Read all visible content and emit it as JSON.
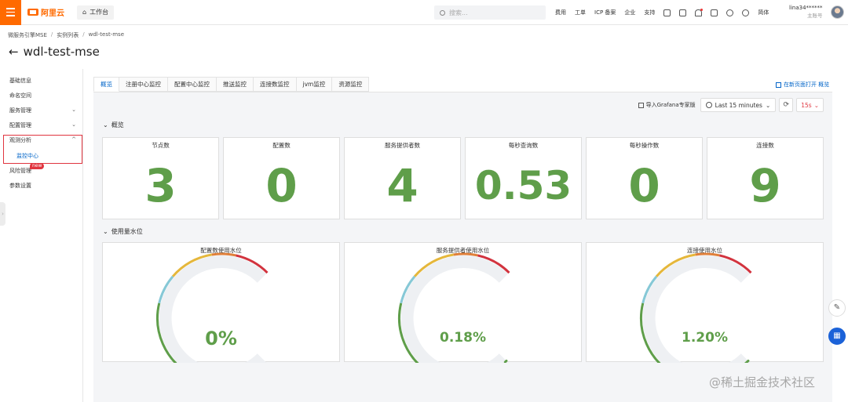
{
  "topbar": {
    "logo_text": "阿里云",
    "workbench_label": "工作台",
    "search_placeholder": "搜索...",
    "links": [
      "费用",
      "工单",
      "ICP 备案",
      "企业",
      "支持"
    ],
    "lang": "简体",
    "user_name": "lina34******",
    "user_role": "主账号"
  },
  "breadcrumb": [
    "微服务引擎MSE",
    "实例列表",
    "wdl-test-mse"
  ],
  "page_title": "wdl-test-mse",
  "sidebar": {
    "items": [
      {
        "label": "基础信息",
        "chevron": ""
      },
      {
        "label": "命名空间",
        "chevron": ""
      },
      {
        "label": "服务管理",
        "chevron": "⌄"
      },
      {
        "label": "配置管理",
        "chevron": "⌄"
      },
      {
        "label": "观测分析",
        "chevron": "^"
      },
      {
        "label": "风险管理",
        "chevron": ""
      },
      {
        "label": "参数设置",
        "chevron": ""
      }
    ],
    "sub_item": "监控中心",
    "new_badge": "new"
  },
  "tabs": [
    "概览",
    "注册中心监控",
    "配置中心监控",
    "推送监控",
    "连接数监控",
    "jvm监控",
    "资源监控"
  ],
  "active_tab": 0,
  "new_window_link": "在新页面打开 概览",
  "toolbar": {
    "import_label": "导入Grafana专家版",
    "time_range": "Last 15 minutes",
    "refresh_interval": "15s"
  },
  "sections": {
    "overview": "概览",
    "water_level": "使用量水位"
  },
  "stats": [
    {
      "label": "节点数",
      "value": "3"
    },
    {
      "label": "配置数",
      "value": "0"
    },
    {
      "label": "服务提供者数",
      "value": "4"
    },
    {
      "label": "每秒查询数",
      "value": "0.53"
    },
    {
      "label": "每秒操作数",
      "value": "0"
    },
    {
      "label": "连接数",
      "value": "9"
    }
  ],
  "gauges": [
    {
      "label": "配置数使用水位",
      "value_text": "0%",
      "fraction": 0.0
    },
    {
      "label": "服务提供者使用水位",
      "value_text": "0.18%",
      "fraction": 0.0018
    },
    {
      "label": "连接使用水位",
      "value_text": "1.20%",
      "fraction": 0.012
    }
  ],
  "watermark": "@稀土掘金技术社区",
  "colors": {
    "brand": "#ff6a00",
    "link": "#0064c8",
    "value_green": "#5f9e4a",
    "highlight_red": "#e0353f",
    "gauge_bands": [
      "#5f9e4a",
      "#86c8d6",
      "#e5b73b",
      "#e0803a",
      "#d2333e"
    ]
  }
}
